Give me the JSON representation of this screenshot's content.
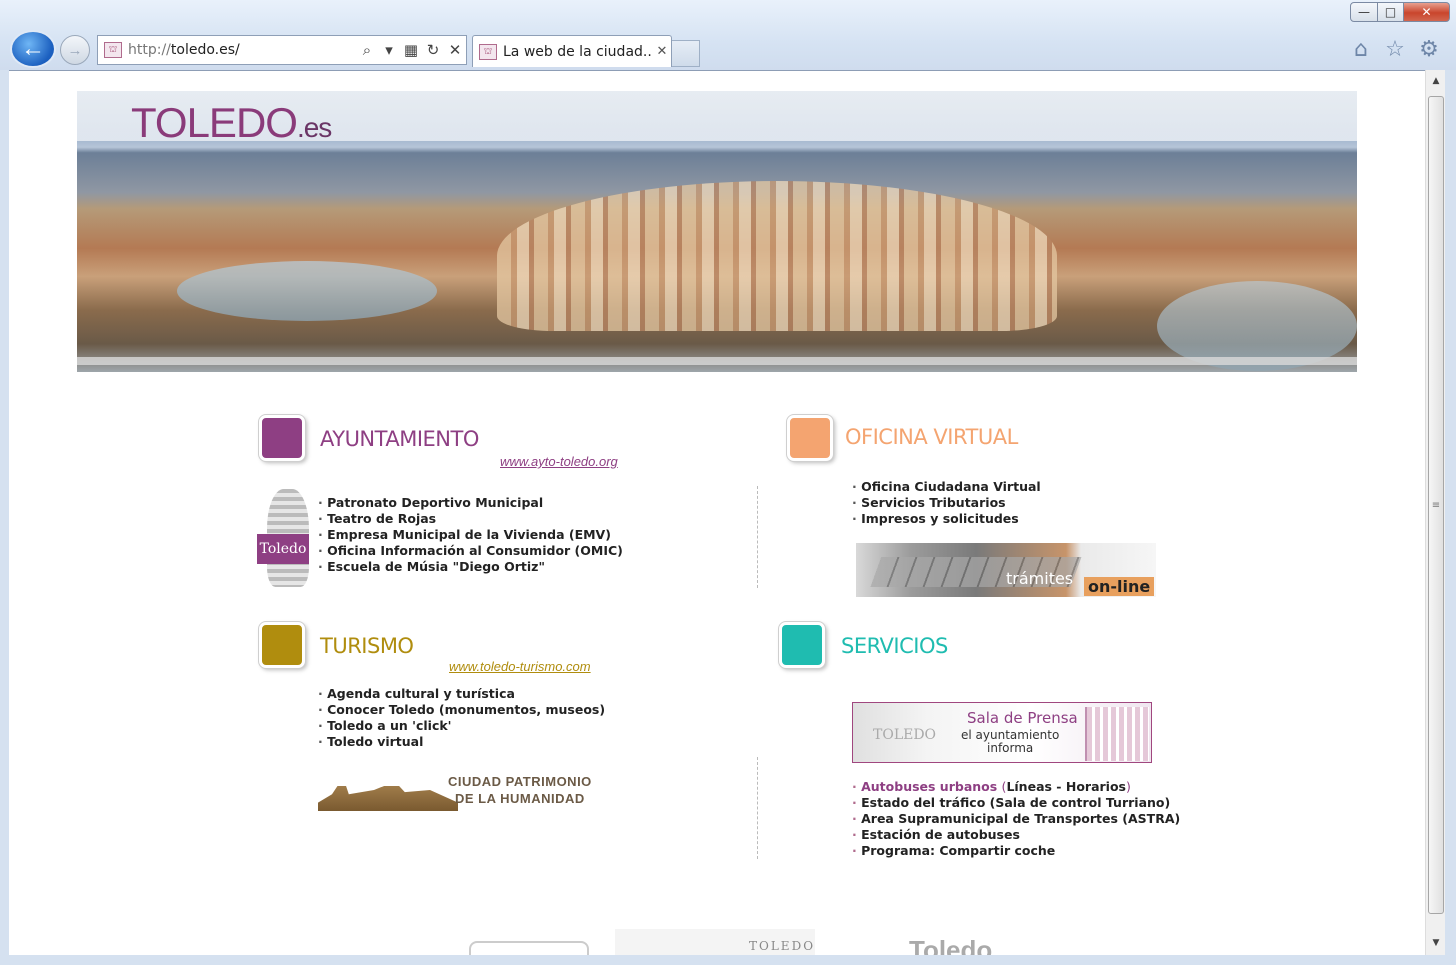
{
  "browser": {
    "url_proto": "http://",
    "url_host": "toledo.es/",
    "tab_title": "La web de la ciudad...",
    "window_min": "—",
    "window_max": "□",
    "window_close": "✕",
    "back_glyph": "←",
    "forward_glyph": "→",
    "search_glyph": "⌕",
    "dropdown_glyph": "▾",
    "compat_glyph": "▦",
    "refresh_glyph": "↻",
    "stop_glyph": "✕",
    "tab_close_glyph": "✕",
    "home_glyph": "⌂",
    "favorites_glyph": "☆",
    "tools_glyph": "⚙",
    "scroll_up": "▲",
    "scroll_down": "▼",
    "scroll_grip": "≡"
  },
  "page": {
    "logo": "TOLEDO",
    "logo_suffix": ".es",
    "ayuntamiento": {
      "title": "AYUNTAMIENTO",
      "url": "www.ayto-toledo.org",
      "color": "#8e3f83",
      "badge": "Toledo",
      "links": [
        "Patronato Deportivo Municipal",
        "Teatro de Rojas",
        "Empresa Municipal de la Vivienda (EMV)",
        "Oficina Información al Consumidor (OMIC)",
        "Escuela de Músia \"Diego Ortiz\""
      ]
    },
    "oficina": {
      "title": "OFICINA VIRTUAL",
      "color": "#f4a470",
      "links": [
        "Oficina Ciudadana Virtual",
        "Servicios Tributarios",
        "Impresos y solicitudes"
      ],
      "banner_text": "trámites",
      "banner_text2": "on-line"
    },
    "turismo": {
      "title": "TURISMO",
      "url": "www.toledo-turismo.com",
      "color": "#b08d0e",
      "links": [
        "Agenda cultural y turística",
        "Conocer Toledo (monumentos, museos)",
        "Toledo a un 'click'",
        "Toledo virtual"
      ],
      "patrimonio_line1": "CIUDAD PATRIMONIO",
      "patrimonio_line2": "DE LA HUMANIDAD"
    },
    "servicios": {
      "title": "SERVICIOS",
      "color": "#1fbcb0",
      "prensa_bg": "TOLEDO",
      "prensa_title": "Sala de Prensa",
      "prensa_sub1": "el ayuntamiento",
      "prensa_sub2": "informa",
      "bus_label": "Autobuses urbanos",
      "bus_open": "(",
      "bus_lineas": "Líneas",
      "bus_sep": " - ",
      "bus_horarios": "Horarios",
      "bus_close": ")",
      "links": [
        "Estado del tráfico (Sala de control Turriano)",
        "Area Supramunicipal de Transportes (ASTRA)",
        "Estación de autobuses",
        "Programa: Compartir coche"
      ]
    },
    "footer": {
      "logo2": "TOLEDO",
      "logo3": "Toledo"
    }
  }
}
